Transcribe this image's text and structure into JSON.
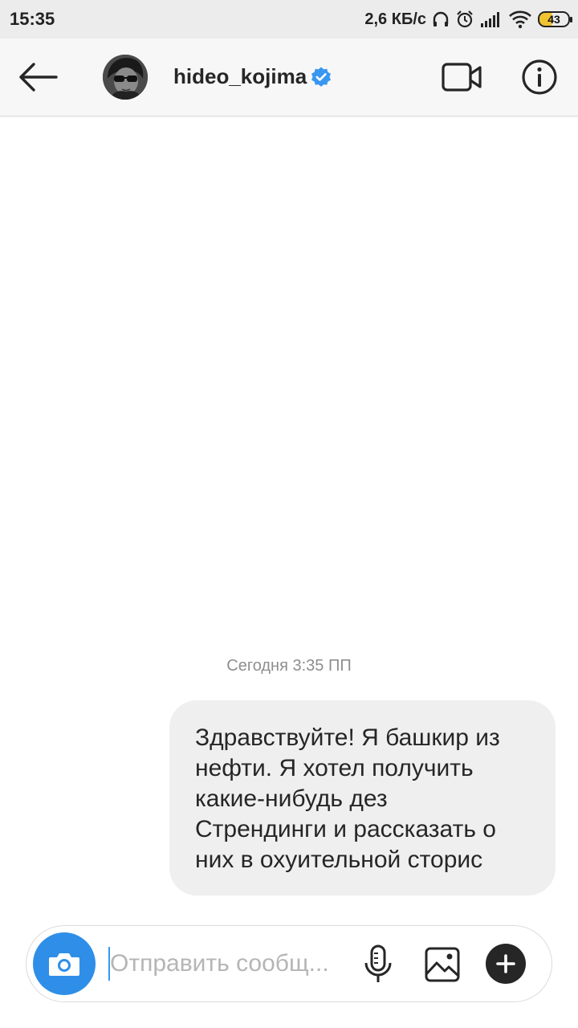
{
  "status_bar": {
    "time": "15:35",
    "net_speed": "2,6 КБ/с",
    "battery": "43",
    "icons": [
      "headphones-icon",
      "alarm-icon",
      "signal-icon",
      "wifi-icon",
      "battery-icon"
    ]
  },
  "header": {
    "username": "hideo_kojima",
    "verified": true,
    "icons": [
      "back-arrow-icon",
      "avatar",
      "verified-badge-icon",
      "video-call-icon",
      "info-icon"
    ],
    "colors": {
      "verified": "#3897f0"
    }
  },
  "thread": {
    "timestamp": "Сегодня 3:35 ПП",
    "messages": [
      {
        "sender": "me",
        "lines": [
          "Здравствуйте! Я башкир из",
          "нефти. Я хотел получить",
          "какие-нибудь дез",
          "Стрендинги и рассказать о",
          "них в охуительной сторис"
        ]
      }
    ]
  },
  "composer": {
    "placeholder": "Отправить сообщ...",
    "value": "",
    "icons": [
      "camera-icon",
      "microphone-icon",
      "gallery-icon",
      "plus-icon"
    ],
    "colors": {
      "camera_button": "#2f8fe8",
      "cursor": "#3897f0"
    }
  }
}
